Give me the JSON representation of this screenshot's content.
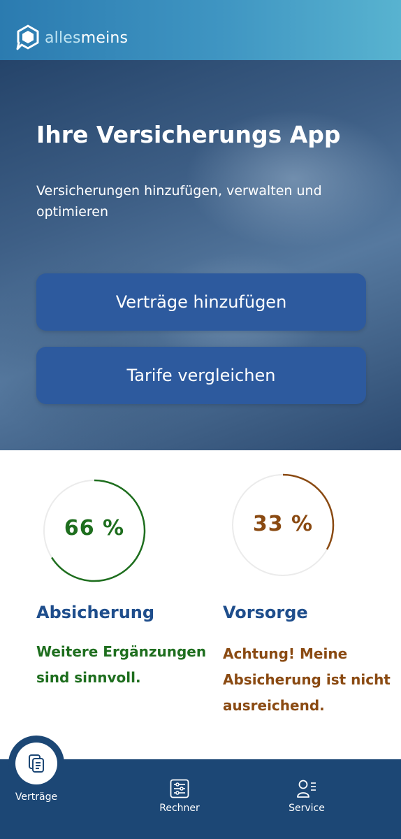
{
  "header": {
    "logo_text_part1": "alles",
    "logo_text_part2": "meins",
    "brand_color": "#3f95c2"
  },
  "hero": {
    "title": "Ihre Versicherungs App",
    "subtitle": "Versicherungen hinzufügen, verwalten und optimieren",
    "primary_button_label": "Verträge hinzufügen",
    "secondary_button_label": "Tarife vergleichen",
    "button_color": "#2d5a9e"
  },
  "stats": [
    {
      "percent_label": "66 %",
      "value": 0.66,
      "title": "Absicherung",
      "message_line1": "Weitere Ergänzungen",
      "message_line2": "sind sinnvoll.",
      "color": "#1e6e1e"
    },
    {
      "percent_label": "33 %",
      "value": 0.33,
      "title": "Vorsorge",
      "message_line1": "Achtung! Meine",
      "message_line2": "Absicherung ist nicht",
      "message_line3": "ausreichend.",
      "color": "#8a4a12"
    }
  ],
  "bottom_nav": {
    "items": [
      {
        "label": "Verträge",
        "icon": "documents-icon",
        "active": true
      },
      {
        "label": "Rechner",
        "icon": "sliders-icon",
        "active": false
      },
      {
        "label": "Service",
        "icon": "person-list-icon",
        "active": false
      }
    ],
    "background": "#1c4775"
  }
}
